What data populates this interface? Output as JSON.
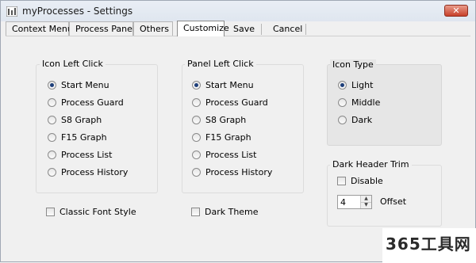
{
  "window": {
    "title": "myProcesses - Settings",
    "close_glyph": "✕"
  },
  "tabs": [
    {
      "label": "Context Menu"
    },
    {
      "label": "Process Panel"
    },
    {
      "label": "Others"
    },
    {
      "label": "Customize"
    },
    {
      "label": "Save"
    },
    {
      "label": "Cancel"
    }
  ],
  "icon_left_click": {
    "title": "Icon Left Click",
    "options": [
      "Start Menu",
      "Process Guard",
      "S8 Graph",
      "F15 Graph",
      "Process List",
      "Process History"
    ],
    "selected": "Start Menu"
  },
  "panel_left_click": {
    "title": "Panel Left Click",
    "options": [
      "Start Menu",
      "Process Guard",
      "S8 Graph",
      "F15 Graph",
      "Process List",
      "Process History"
    ],
    "selected": "Start Menu"
  },
  "icon_type": {
    "title": "Icon Type",
    "options": [
      "Light",
      "Middle",
      "Dark"
    ],
    "selected": "Light"
  },
  "dark_header_trim": {
    "title": "Dark Header Trim",
    "disable_label": "Disable",
    "disable_checked": false,
    "offset_value": "4",
    "offset_label": "Offset"
  },
  "classic_font_style": {
    "label": "Classic Font Style",
    "checked": false
  },
  "dark_theme": {
    "label": "Dark Theme",
    "checked": false
  },
  "watermark": {
    "text": "365工具网"
  },
  "colors": {
    "titlebar": "#dfe6ef",
    "close_button": "#c7402a",
    "radio_dot": "#1e3f7a",
    "background": "#f0f0f0"
  }
}
